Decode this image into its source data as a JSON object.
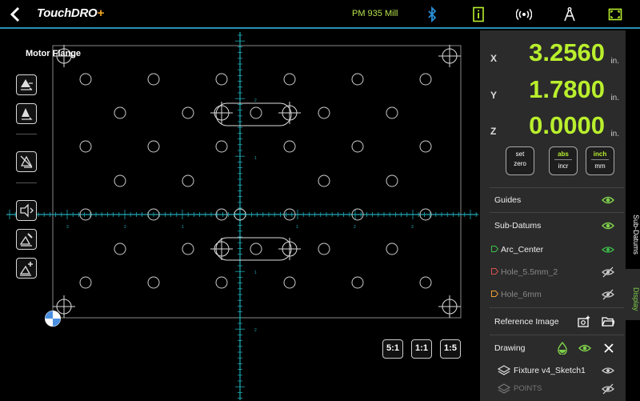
{
  "header": {
    "logo_main": "TouchDRO",
    "logo_plus": "+",
    "logo_sub": "",
    "machine": "PM 935 Mill"
  },
  "drawing": {
    "title": "Motor Flange",
    "zoom_buttons": [
      "5:1",
      "1:1",
      "1:5"
    ],
    "axis_ticks_x": [
      "3",
      "2",
      "1",
      "1",
      "2",
      "3"
    ],
    "axis_ticks_y": [
      "2",
      "1",
      "1",
      "2"
    ]
  },
  "readout": {
    "x_label": "X",
    "x_value": "3.2560",
    "x_unit": "in.",
    "y_label": "Y",
    "y_value": "1.7800",
    "y_unit": "in.",
    "z_label": "Z",
    "z_value": "0.0000",
    "z_unit": "in.",
    "set_zero_top": "set",
    "set_zero_bottom": "zero",
    "abs_label": "abs",
    "incr_label": "incr",
    "inch_label": "inch",
    "mm_label": "mm"
  },
  "display_panel": {
    "guides": "Guides",
    "sub_datums": "Sub-Datums",
    "datums": [
      {
        "name": "Arc_Center",
        "color": "#3dbf4a",
        "visible": true
      },
      {
        "name": "Hole_5.5mm_2",
        "color": "#d9534f",
        "visible": false
      },
      {
        "name": "Hole_6mm",
        "color": "#f0a030",
        "visible": false
      }
    ],
    "reference_image": "Reference Image",
    "drawing": "Drawing",
    "layers": [
      {
        "name": "Fixture v4_Sketch1",
        "visible": true
      },
      {
        "name": "POINTS",
        "visible": false
      }
    ]
  },
  "side_tabs": {
    "sub_datums": "Sub-Datums",
    "display": "Display"
  },
  "colors": {
    "accent_green": "#b9ef2d",
    "grid_cyan": "#1fa9b5",
    "active_tab": "#7fd04a"
  }
}
